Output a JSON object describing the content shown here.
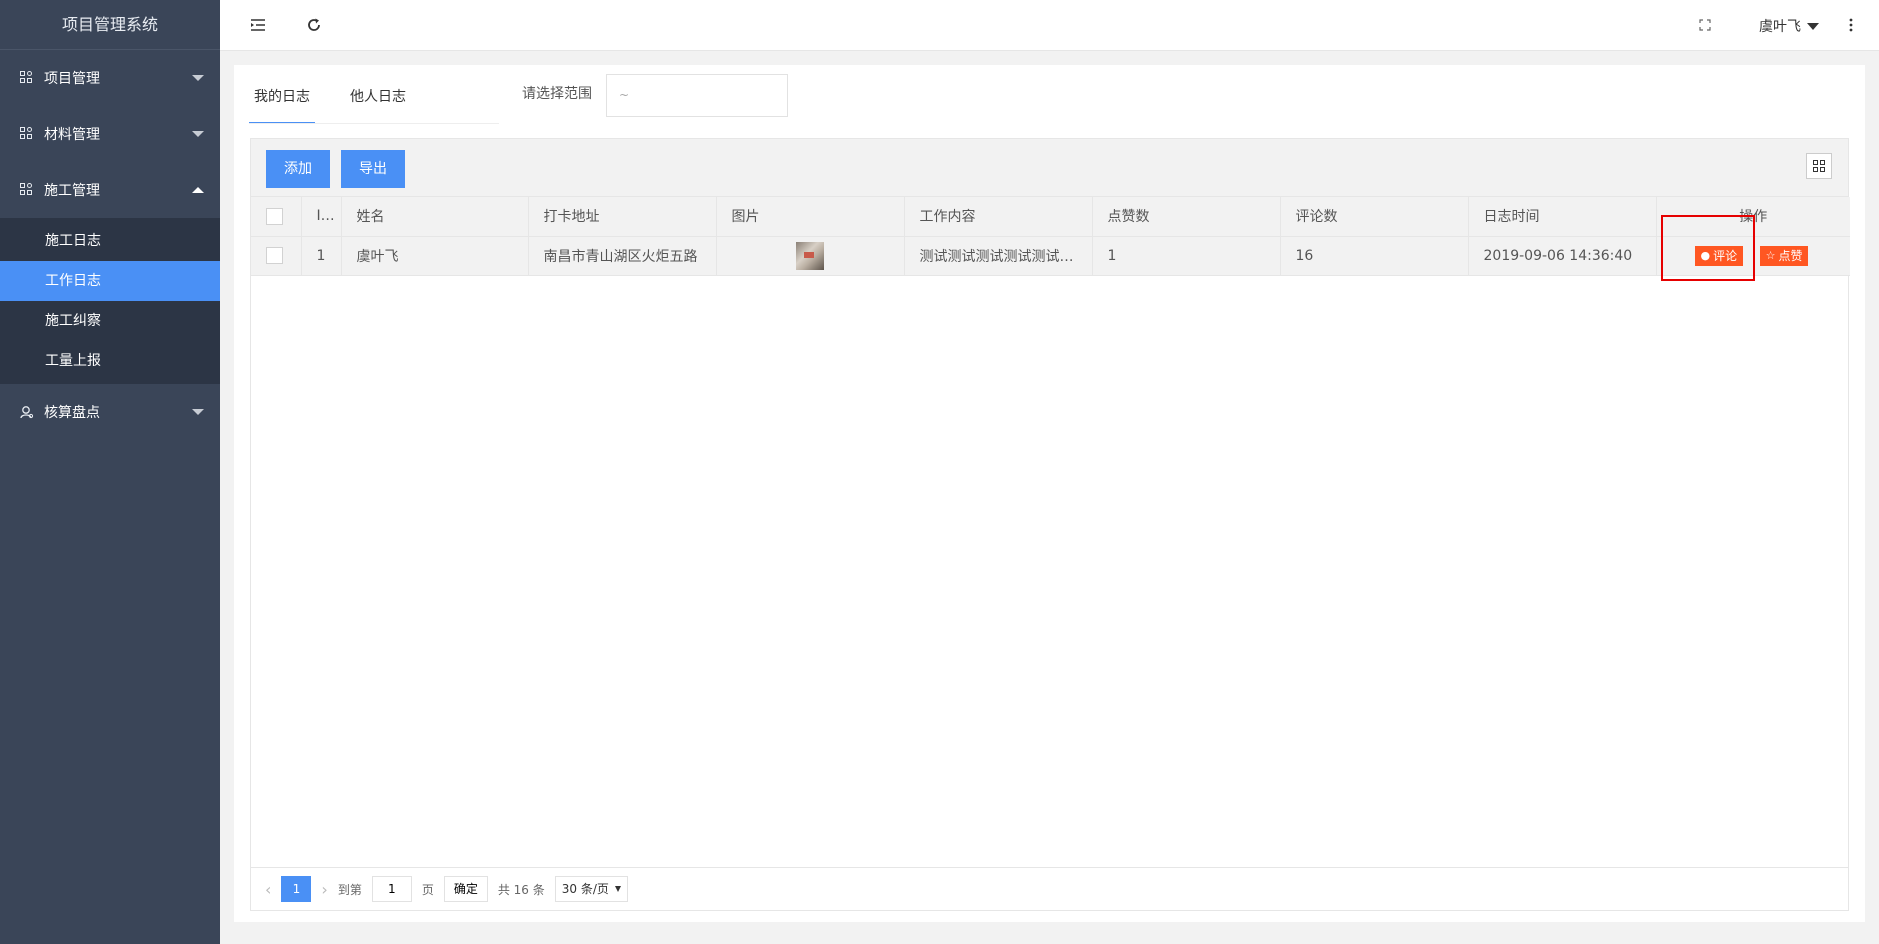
{
  "app_title": "项目管理系统",
  "sidebar": {
    "groups": [
      {
        "label": "项目管理",
        "expanded": false
      },
      {
        "label": "材料管理",
        "expanded": false
      },
      {
        "label": "施工管理",
        "expanded": true,
        "items": [
          "施工日志",
          "工作日志",
          "施工纠察",
          "工量上报"
        ],
        "active_item": "工作日志"
      },
      {
        "label": "核算盘点",
        "expanded": false
      }
    ]
  },
  "header": {
    "user": "虞叶飞"
  },
  "tabs": [
    "我的日志",
    "他人日志"
  ],
  "range": {
    "label": "请选择范围",
    "placeholder": "~"
  },
  "toolbar": {
    "add": "添加",
    "export": "导出"
  },
  "table": {
    "columns": [
      "ID",
      "姓名",
      "打卡地址",
      "图片",
      "工作内容",
      "点赞数",
      "评论数",
      "日志时间",
      "操作"
    ],
    "rows": [
      {
        "id": "1",
        "name": "虞叶飞",
        "address": "南昌市青山湖区火炬五路",
        "content": "测试测试测试测试测试测试",
        "likes": "1",
        "comments": "16",
        "time": "2019-09-06 14:36:40"
      }
    ],
    "actions": {
      "comment": "评论",
      "like": "点赞"
    }
  },
  "pager": {
    "current": "1",
    "goto_label": "到第",
    "goto_value": "1",
    "page_unit": "页",
    "confirm": "确定",
    "total": "共 16 条",
    "per_page": "30 条/页"
  },
  "colors": {
    "sidebar": "#3a4558",
    "accent": "#4a90f5",
    "action": "#ff5722",
    "highlight": "#e60000"
  }
}
